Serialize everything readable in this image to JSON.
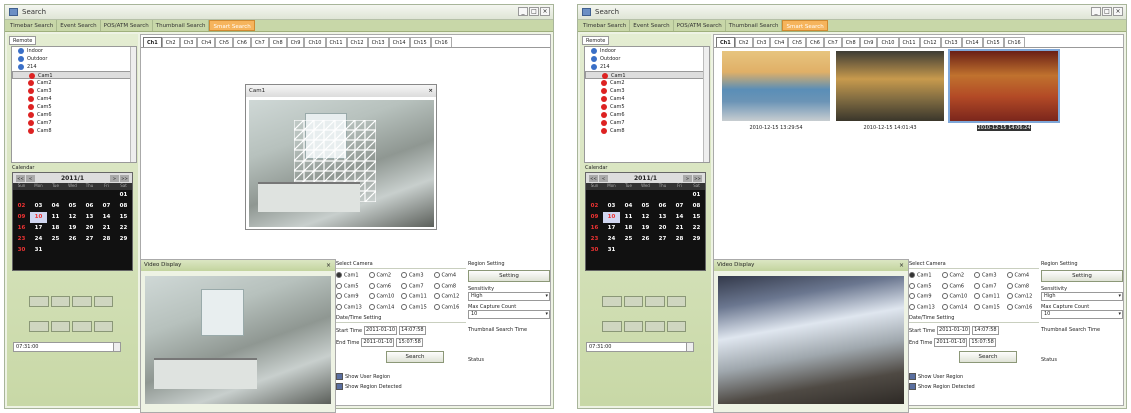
{
  "window": {
    "title": "Search",
    "min": "_",
    "max": "□",
    "close": "×"
  },
  "tabs": [
    "Timebar Search",
    "Event Search",
    "POS/ATM Search",
    "Thumbnail Search",
    "Smart Search"
  ],
  "left": {
    "remote_tab": "Remote",
    "tree": [
      {
        "label": "Indoor",
        "level": 1,
        "color": "#3a6fc7"
      },
      {
        "label": "Outdoor",
        "level": 1,
        "color": "#3a6fc7"
      },
      {
        "label": "214",
        "level": 1,
        "color": "#3a6fc7"
      },
      {
        "label": "Cam1",
        "level": 2,
        "color": "#d22"
      },
      {
        "label": "Cam2",
        "level": 2,
        "color": "#d22"
      },
      {
        "label": "Cam3",
        "level": 2,
        "color": "#d22"
      },
      {
        "label": "Cam4",
        "level": 2,
        "color": "#d22"
      },
      {
        "label": "Cam5",
        "level": 2,
        "color": "#d22"
      },
      {
        "label": "Cam6",
        "level": 2,
        "color": "#d22"
      },
      {
        "label": "Cam7",
        "level": 2,
        "color": "#d22"
      },
      {
        "label": "Cam8",
        "level": 2,
        "color": "#d22"
      }
    ],
    "calendar_label": "Calendar",
    "month": "2011/1",
    "nav": [
      "<<",
      "<",
      ">",
      ">>"
    ],
    "dow": [
      "Sun",
      "Mon",
      "Tue",
      "Wed",
      "Thu",
      "Fri",
      "Sat"
    ],
    "weeks": [
      [
        "",
        "",
        "",
        "",
        "",
        "",
        "01"
      ],
      [
        "02",
        "03",
        "04",
        "05",
        "06",
        "07",
        "08"
      ],
      [
        "09",
        "10",
        "11",
        "12",
        "13",
        "14",
        "15"
      ],
      [
        "16",
        "17",
        "18",
        "19",
        "20",
        "21",
        "22"
      ],
      [
        "23",
        "24",
        "25",
        "26",
        "27",
        "28",
        "29"
      ],
      [
        "30",
        "31",
        "",
        "",
        "",
        "",
        ""
      ]
    ],
    "today": "10",
    "time": "07:31:00"
  },
  "channels": [
    "Ch1",
    "Ch2",
    "Ch3",
    "Ch4",
    "Ch5",
    "Ch6",
    "Ch7",
    "Ch8",
    "Ch9",
    "Ch10",
    "Ch11",
    "Ch12",
    "Ch13",
    "Ch14",
    "Ch15",
    "Ch16"
  ],
  "popup": {
    "title": "Cam1",
    "close": "×"
  },
  "video_display": {
    "title": "Video Display",
    "close": "×"
  },
  "select_camera": {
    "label": "Select Camera",
    "cams": [
      "Cam1",
      "Cam2",
      "Cam3",
      "Cam4",
      "Cam5",
      "Cam6",
      "Cam7",
      "Cam8",
      "Cam9",
      "Cam10",
      "Cam11",
      "Cam12",
      "Cam13",
      "Cam14",
      "Cam15",
      "Cam16"
    ],
    "selected": "Cam1"
  },
  "datetime": {
    "label": "Date/Time Setting",
    "start_label": "Start Time",
    "start_date": "2011-01-10",
    "start_time": "14:07:58",
    "end_label": "End Time",
    "end_date": "2011-01-10",
    "end_time": "15:07:58"
  },
  "search_button": "Search",
  "checks": [
    {
      "label": "Show User Region",
      "checked": true
    },
    {
      "label": "Show Region Detected",
      "checked": true
    }
  ],
  "region": {
    "label": "Region Setting",
    "setting_button": "Setting",
    "sensitivity_label": "Sensitivity",
    "sensitivity": "High",
    "max_label": "Max Capture Count",
    "max": "10",
    "thumb_time_label": "Thumbnail Search Time",
    "status_label": "Status"
  },
  "thumbnails": [
    {
      "caption": "2010-12-15 13:29:54"
    },
    {
      "caption": "2010-12-15 14:01:43"
    },
    {
      "caption": "2010-12-15 14:06:24"
    }
  ]
}
